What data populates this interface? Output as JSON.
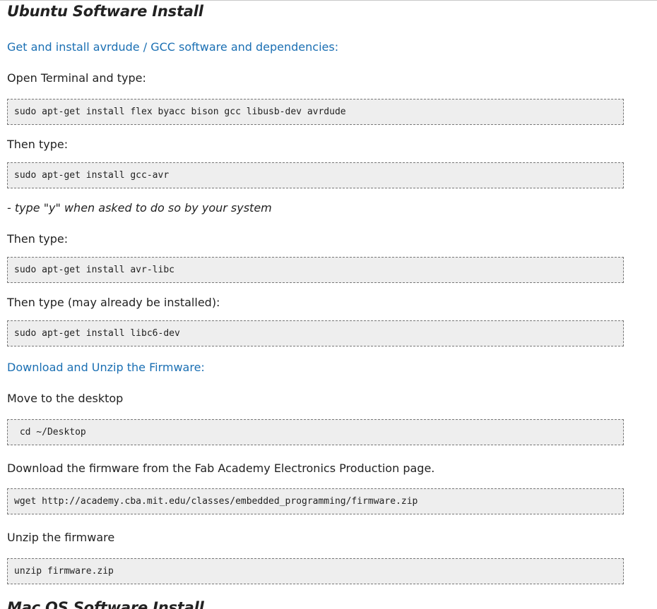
{
  "ubuntu_section": {
    "title": "Ubuntu Software Install",
    "step1_link": "Get and install avrdude / GCC software and dependencies:",
    "step1_text": "Open Terminal and type:",
    "cmd1": "sudo apt-get install flex byacc bison gcc libusb-dev avrdude",
    "then1": "Then type:",
    "cmd2": "sudo apt-get install gcc-avr",
    "note": "- type \"y\" when asked to do so by your system",
    "then2": "Then type:",
    "cmd3": "sudo apt-get install avr-libc",
    "then3": "Then type (may already be installed):",
    "cmd4": "sudo apt-get install libc6-dev",
    "step2_link": "Download and Unzip the Firmware:",
    "move_text": "Move to the desktop",
    "cmd5": " cd ~/Desktop",
    "download_text": "Download the firmware from the Fab Academy Electronics Production page.",
    "cmd6": "wget http://academy.cba.mit.edu/classes/embedded_programming/firmware.zip",
    "unzip_text": "Unzip the firmware",
    "cmd7": "unzip firmware.zip"
  },
  "mac_section": {
    "title": "Mac OS Software Install"
  }
}
